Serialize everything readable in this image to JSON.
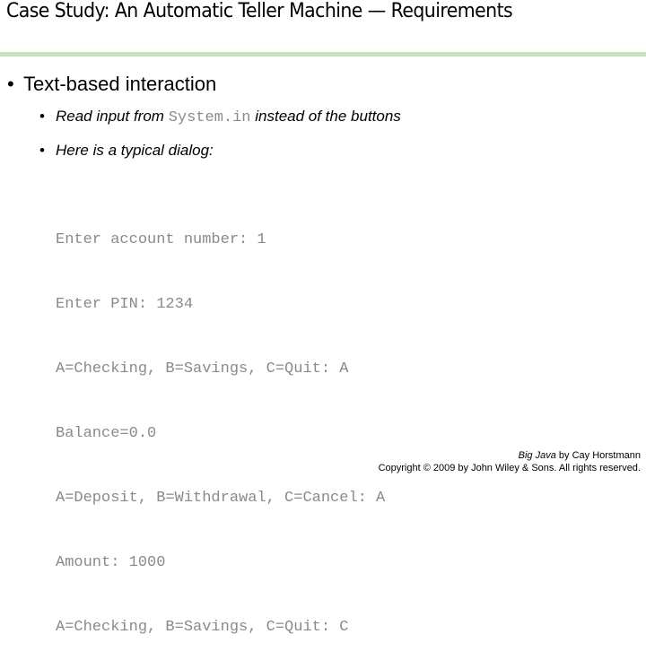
{
  "slide": {
    "title": "Case Study: An Automatic Teller Machine — Requirements",
    "accent_color": "#c9e4bc",
    "bullets": {
      "main": {
        "glyph": "•",
        "text": "Text-based interaction"
      },
      "sub1": {
        "glyph": "•",
        "before": "Read input from ",
        "code": "System.in",
        "after": " instead of the buttons"
      },
      "sub2": {
        "glyph": "•",
        "text": "Here is a typical dialog:"
      }
    },
    "dialog_lines": [
      "Enter account number: 1",
      "Enter PIN: 1234",
      "A=Checking, B=Savings, C=Quit: A",
      "Balance=0.0",
      "A=Deposit, B=Withdrawal, C=Cancel: A",
      "Amount: 1000",
      "A=Checking, B=Savings, C=Quit: C"
    ],
    "footer": {
      "book_title": "Big Java",
      "author_text": " by Cay Horstmann",
      "copyright": "Copyright © 2009 by John Wiley & Sons.  All rights reserved."
    }
  }
}
